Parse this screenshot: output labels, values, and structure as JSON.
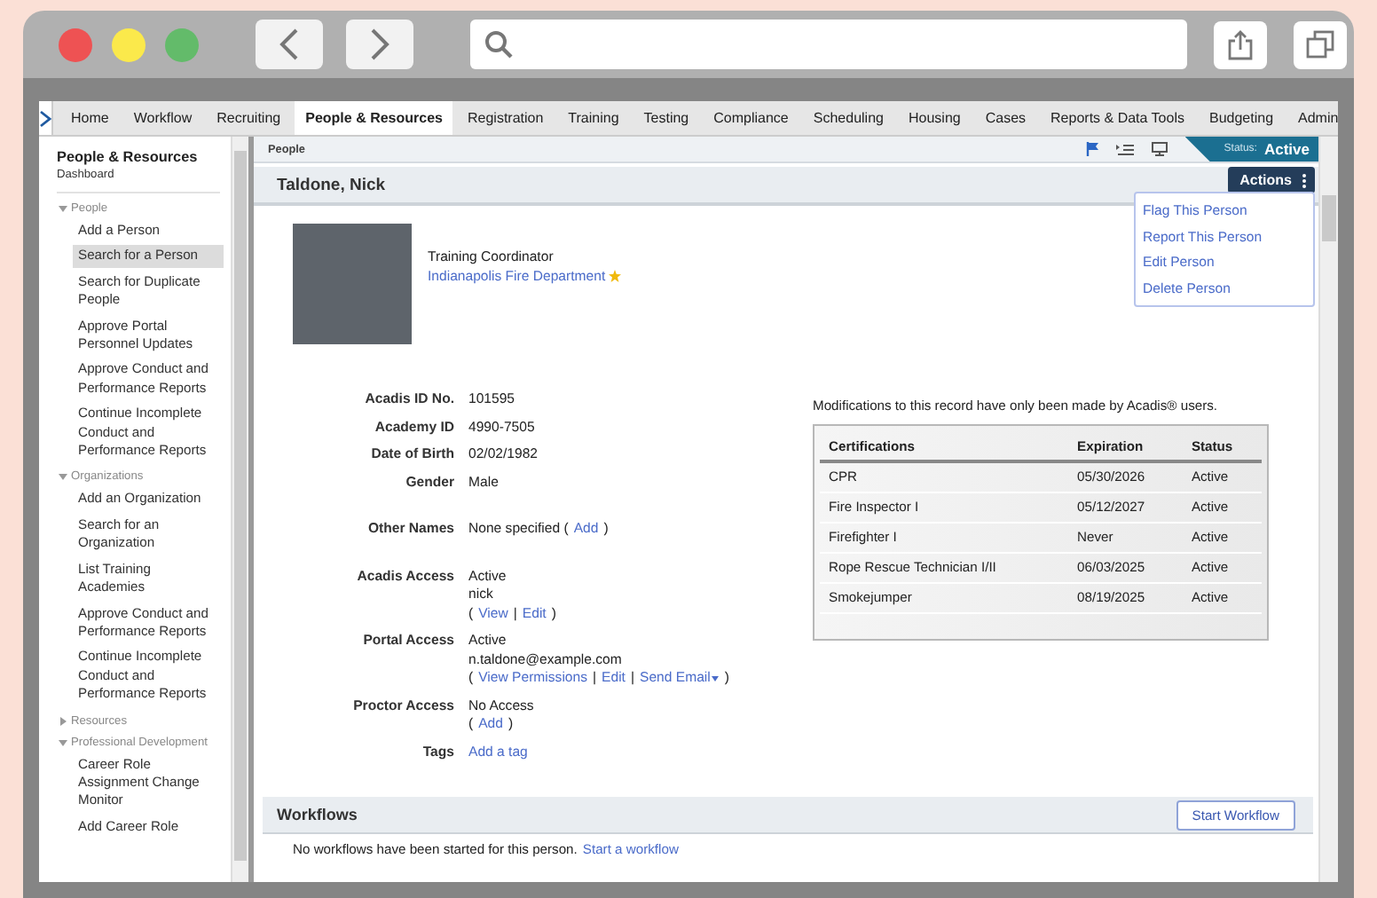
{
  "nav": {
    "items": [
      {
        "label": "Home",
        "selected": false
      },
      {
        "label": "Workflow",
        "selected": false
      },
      {
        "label": "Recruiting",
        "selected": false
      },
      {
        "label": "People & Resources",
        "selected": true
      },
      {
        "label": "Registration",
        "selected": false
      },
      {
        "label": "Training",
        "selected": false
      },
      {
        "label": "Testing",
        "selected": false
      },
      {
        "label": "Compliance",
        "selected": false
      },
      {
        "label": "Scheduling",
        "selected": false
      },
      {
        "label": "Housing",
        "selected": false
      },
      {
        "label": "Cases",
        "selected": false
      },
      {
        "label": "Reports & Data Tools",
        "selected": false
      },
      {
        "label": "Budgeting",
        "selected": false
      },
      {
        "label": "Admin",
        "selected": false
      }
    ]
  },
  "sidebar": {
    "title": "People & Resources",
    "subtitle": "Dashboard",
    "sections": [
      {
        "label": "People",
        "expanded": true,
        "children": [
          {
            "label": "Add a Person",
            "selected": false
          },
          {
            "label": "Search for a Person",
            "selected": true
          },
          {
            "label": "Search for Duplicate People",
            "selected": false
          },
          {
            "label": "Approve Portal Personnel Updates",
            "selected": false
          },
          {
            "label": "Approve Conduct and Performance Reports",
            "selected": false
          },
          {
            "label": "Continue Incomplete Conduct and Performance Reports",
            "selected": false
          }
        ]
      },
      {
        "label": "Organizations",
        "expanded": true,
        "children": [
          {
            "label": "Add an Organization",
            "selected": false
          },
          {
            "label": "Search for an Organization",
            "selected": false
          },
          {
            "label": "List Training Academies",
            "selected": false
          },
          {
            "label": "Approve Conduct and Performance Reports",
            "selected": false
          },
          {
            "label": "Continue Incomplete Conduct and Performance Reports",
            "selected": false
          }
        ]
      },
      {
        "label": "Resources",
        "expanded": false
      },
      {
        "label": "Professional Development",
        "expanded": true,
        "children": [
          {
            "label": "Career Role Assignment Change Monitor",
            "selected": false
          },
          {
            "label": "Add Career Role",
            "selected": false
          }
        ]
      }
    ]
  },
  "header": {
    "breadcrumb": "People",
    "status_label": "Status:",
    "status": "Active"
  },
  "person": {
    "name": "Taldone, Nick",
    "role": "Training Coordinator",
    "organization": "Indianapolis Fire Department",
    "favorite": true
  },
  "actions": {
    "label": "Actions",
    "expanded": true,
    "items": [
      "Flag This Person",
      "Report This Person",
      "Edit Person",
      "Delete Person"
    ]
  },
  "details": [
    [
      {
        "label": "Acadis ID No.",
        "lines": [
          [
            {
              "kind": "text",
              "text": "101595"
            }
          ]
        ]
      },
      {
        "label": "Academy ID",
        "lines": [
          [
            {
              "kind": "text",
              "text": "4990-7505"
            }
          ]
        ]
      },
      {
        "label": "Date of Birth",
        "lines": [
          [
            {
              "kind": "text",
              "text": "02/02/1982"
            }
          ]
        ]
      },
      {
        "label": "Gender",
        "lines": [
          [
            {
              "kind": "text",
              "text": "Male"
            }
          ]
        ]
      }
    ],
    [
      {
        "label": "Other Names",
        "lines": [
          [
            {
              "kind": "text",
              "text": "None specified ("
            },
            {
              "kind": "link",
              "text": "Add"
            },
            {
              "kind": "text",
              "text": ")"
            }
          ]
        ]
      }
    ],
    [
      {
        "label": "Acadis Access",
        "lines": [
          [
            {
              "kind": "text",
              "text": "Active"
            }
          ],
          [
            {
              "kind": "text",
              "text": "nick"
            }
          ],
          [
            {
              "kind": "text",
              "text": "("
            },
            {
              "kind": "link",
              "text": "View"
            },
            {
              "kind": "text",
              "text": "|"
            },
            {
              "kind": "link",
              "text": "Edit"
            },
            {
              "kind": "text",
              "text": ")"
            }
          ]
        ]
      },
      {
        "label": "Portal Access",
        "lines": [
          [
            {
              "kind": "text",
              "text": "Active"
            }
          ],
          [
            {
              "kind": "text",
              "text": "n.taldone@example.com"
            }
          ],
          [
            {
              "kind": "text",
              "text": "("
            },
            {
              "kind": "link",
              "text": "View Permissions"
            },
            {
              "kind": "text",
              "text": "|"
            },
            {
              "kind": "link",
              "text": "Edit"
            },
            {
              "kind": "text",
              "text": "|"
            },
            {
              "kind": "menu",
              "text": "Send Email"
            },
            {
              "kind": "text",
              "text": ")"
            }
          ]
        ]
      },
      {
        "label": "Proctor Access",
        "lines": [
          [
            {
              "kind": "text",
              "text": "No Access"
            }
          ],
          [
            {
              "kind": "text",
              "text": "("
            },
            {
              "kind": "link",
              "text": "Add"
            },
            {
              "kind": "text",
              "text": ")"
            }
          ]
        ]
      },
      {
        "label": "Tags",
        "lines": [
          [
            {
              "kind": "link",
              "text": "Add a tag"
            }
          ]
        ]
      }
    ]
  ],
  "modification_note": "Modifications to this record have only been made by Acadis® users.",
  "certifications": {
    "columns": [
      "Certifications",
      "Expiration",
      "Status"
    ],
    "rows": [
      [
        "CPR",
        "05/30/2026",
        "Active"
      ],
      [
        "Fire Inspector I",
        "05/12/2027",
        "Active"
      ],
      [
        "Firefighter I",
        "Never",
        "Active"
      ],
      [
        "Rope Rescue Technician I/II",
        "06/03/2025",
        "Active"
      ],
      [
        "Smokejumper",
        "08/19/2025",
        "Active"
      ]
    ]
  },
  "workflows": {
    "title": "Workflows",
    "button": "Start Workflow",
    "empty_text": "No workflows have been started for this person.",
    "link": "Start a workflow"
  }
}
